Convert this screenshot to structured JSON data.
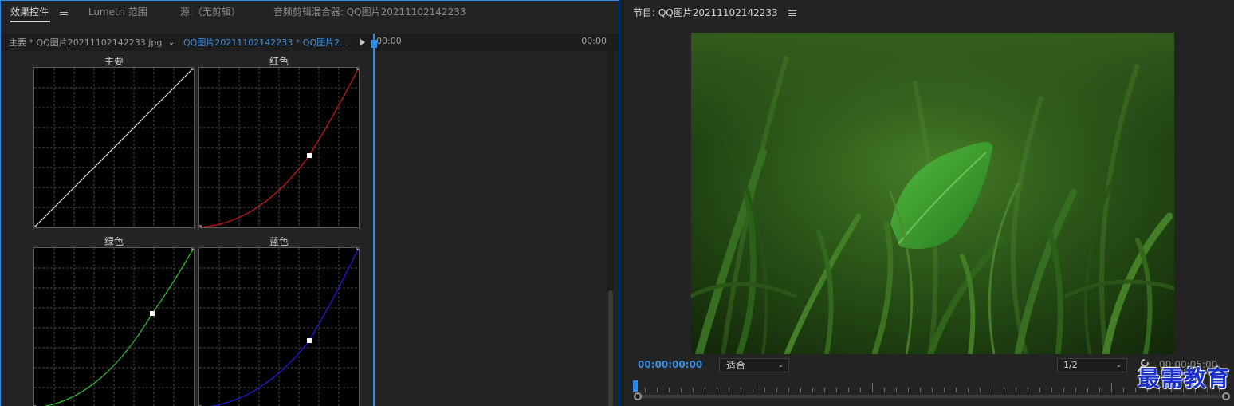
{
  "left_tabs": [
    {
      "label": "效果控件",
      "active": true
    },
    {
      "label": "Lumetri 范围",
      "active": false
    },
    {
      "label": "源:（无剪辑）",
      "active": false
    },
    {
      "label": "音频剪辑混合器: QQ图片20211102142233",
      "active": false
    }
  ],
  "effect_controls": {
    "master_clip": "主要 * QQ图片20211102142233.jpg",
    "sequence_clip": "QQ图片20211102142233 * QQ图片2...",
    "timeline_start": "00:00",
    "timeline_end": "00:00"
  },
  "curves": {
    "master_label": "主要",
    "red_label": "红色",
    "green_label": "绿色",
    "blue_label": "蓝色",
    "colors": {
      "master": "#d9d9d9",
      "red": "#d01818",
      "green": "#2ec82e",
      "blue": "#1e1ee6"
    },
    "control_points": {
      "red": {
        "input": 0.69,
        "output": 0.45
      },
      "green": {
        "input": 0.74,
        "output": 0.59
      },
      "blue": {
        "input": 0.69,
        "output": 0.42
      }
    }
  },
  "program": {
    "title": "节目: QQ图片20211102142233",
    "timecode_current": "00:00:00:00",
    "fit_label": "适合",
    "resolution_label": "1/2",
    "timecode_duration": "00:00:05:00"
  },
  "watermark": "最需教育",
  "accent_color": "#2d8ceb"
}
